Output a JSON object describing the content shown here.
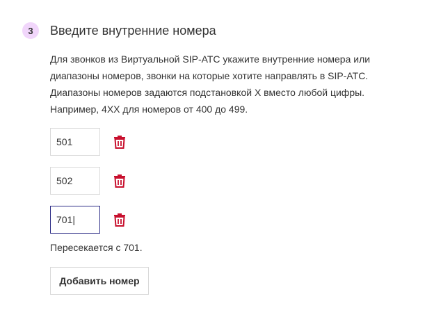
{
  "step": {
    "number": "3",
    "title": "Введите внутренние номера"
  },
  "description": {
    "lines": [
      "Для звонков из Виртуальной SIP-АТС укажите внутренние номера или",
      "диапазоны номеров, звонки на которые хотите направлять в SIP-АТС.",
      "Диапазоны номеров задаются подстановкой Х вместо любой цифры.",
      "Например, 4ХХ для номеров от 400 до 499."
    ]
  },
  "numbers": [
    {
      "value": "501",
      "focused": false
    },
    {
      "value": "502",
      "focused": false
    },
    {
      "value": "701|",
      "focused": true
    }
  ],
  "icons": {
    "delete": "trash-icon"
  },
  "colors": {
    "badge_bg": "#f1d6fb",
    "trash": "#c8102e",
    "focus_border": "#2a2a85"
  },
  "error": "Пересекается с 701.",
  "add_button": "Добавить номер"
}
